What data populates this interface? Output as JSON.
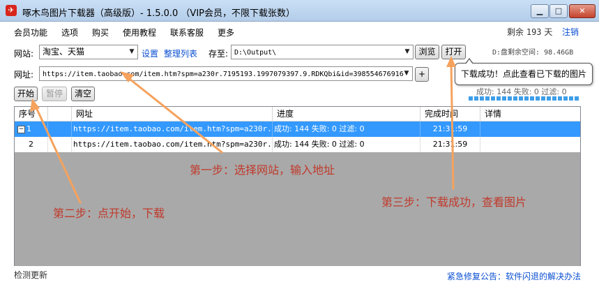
{
  "window": {
    "title": "啄木鸟图片下载器（高级版）- 1.5.0.0 （VIP会员，不限下载张数）",
    "icon": "woodpecker-logo",
    "controls": {
      "minimize": "▁",
      "maximize": "□",
      "close": "✕"
    }
  },
  "menu": {
    "items": [
      "会员功能",
      "选项",
      "购买",
      "使用教程",
      "联系客服",
      "更多"
    ],
    "remaining_prefix": "剩余",
    "remaining_days": "193",
    "remaining_suffix": "天",
    "logout": "注销"
  },
  "site_row": {
    "site_label": "网站:",
    "site_value": "淘宝、天猫",
    "settings_link": "设置",
    "organize_link": "整理列表",
    "save_label": "存至:",
    "save_path": "D:\\Output\\",
    "browse_button": "浏览",
    "open_button": "打开",
    "disk_space": "D:盘剩余空间: 98.46GB"
  },
  "url_row": {
    "url_label": "网址:",
    "url_value": "https://item.taobao.com/item.htm?spm=a230r.7195193.1997079397.9.RDKQbi&id=398554676916",
    "add_button": "+"
  },
  "actions": {
    "start_button": "开始",
    "pause_button": "暂停",
    "clear_button": "清空"
  },
  "tooltip": "下载成功！点此查看已下载的图片",
  "stats": "成功: 144 失败: 0 过滤: 0",
  "table": {
    "columns": [
      "序号",
      "网址",
      "进度",
      "完成时间",
      "详情"
    ],
    "rows": [
      {
        "index": "1",
        "url": "https://item.taobao.com/item.htm?spm=a230r....",
        "progress": "成功: 144 失败: 0 过滤: 0",
        "time": "21:31:59",
        "detail": "",
        "selected": true
      },
      {
        "index": "2",
        "url": "https://item.taobao.com/item.htm?spm=a230r....",
        "progress": "成功: 144 失败: 0 过滤: 0",
        "time": "21:31:59",
        "detail": "",
        "selected": false
      }
    ]
  },
  "annotations": {
    "step1": "第一步：选择网站，输入地址",
    "step2": "第二步：点开始，下载",
    "step3": "第三步：下载成功，查看图片",
    "arrow_color": "#f5a25d",
    "text_color": "#c0392b"
  },
  "status": {
    "check_update": "检测更新",
    "notice": "紧急修复公告：软件闪退的解决办法"
  }
}
